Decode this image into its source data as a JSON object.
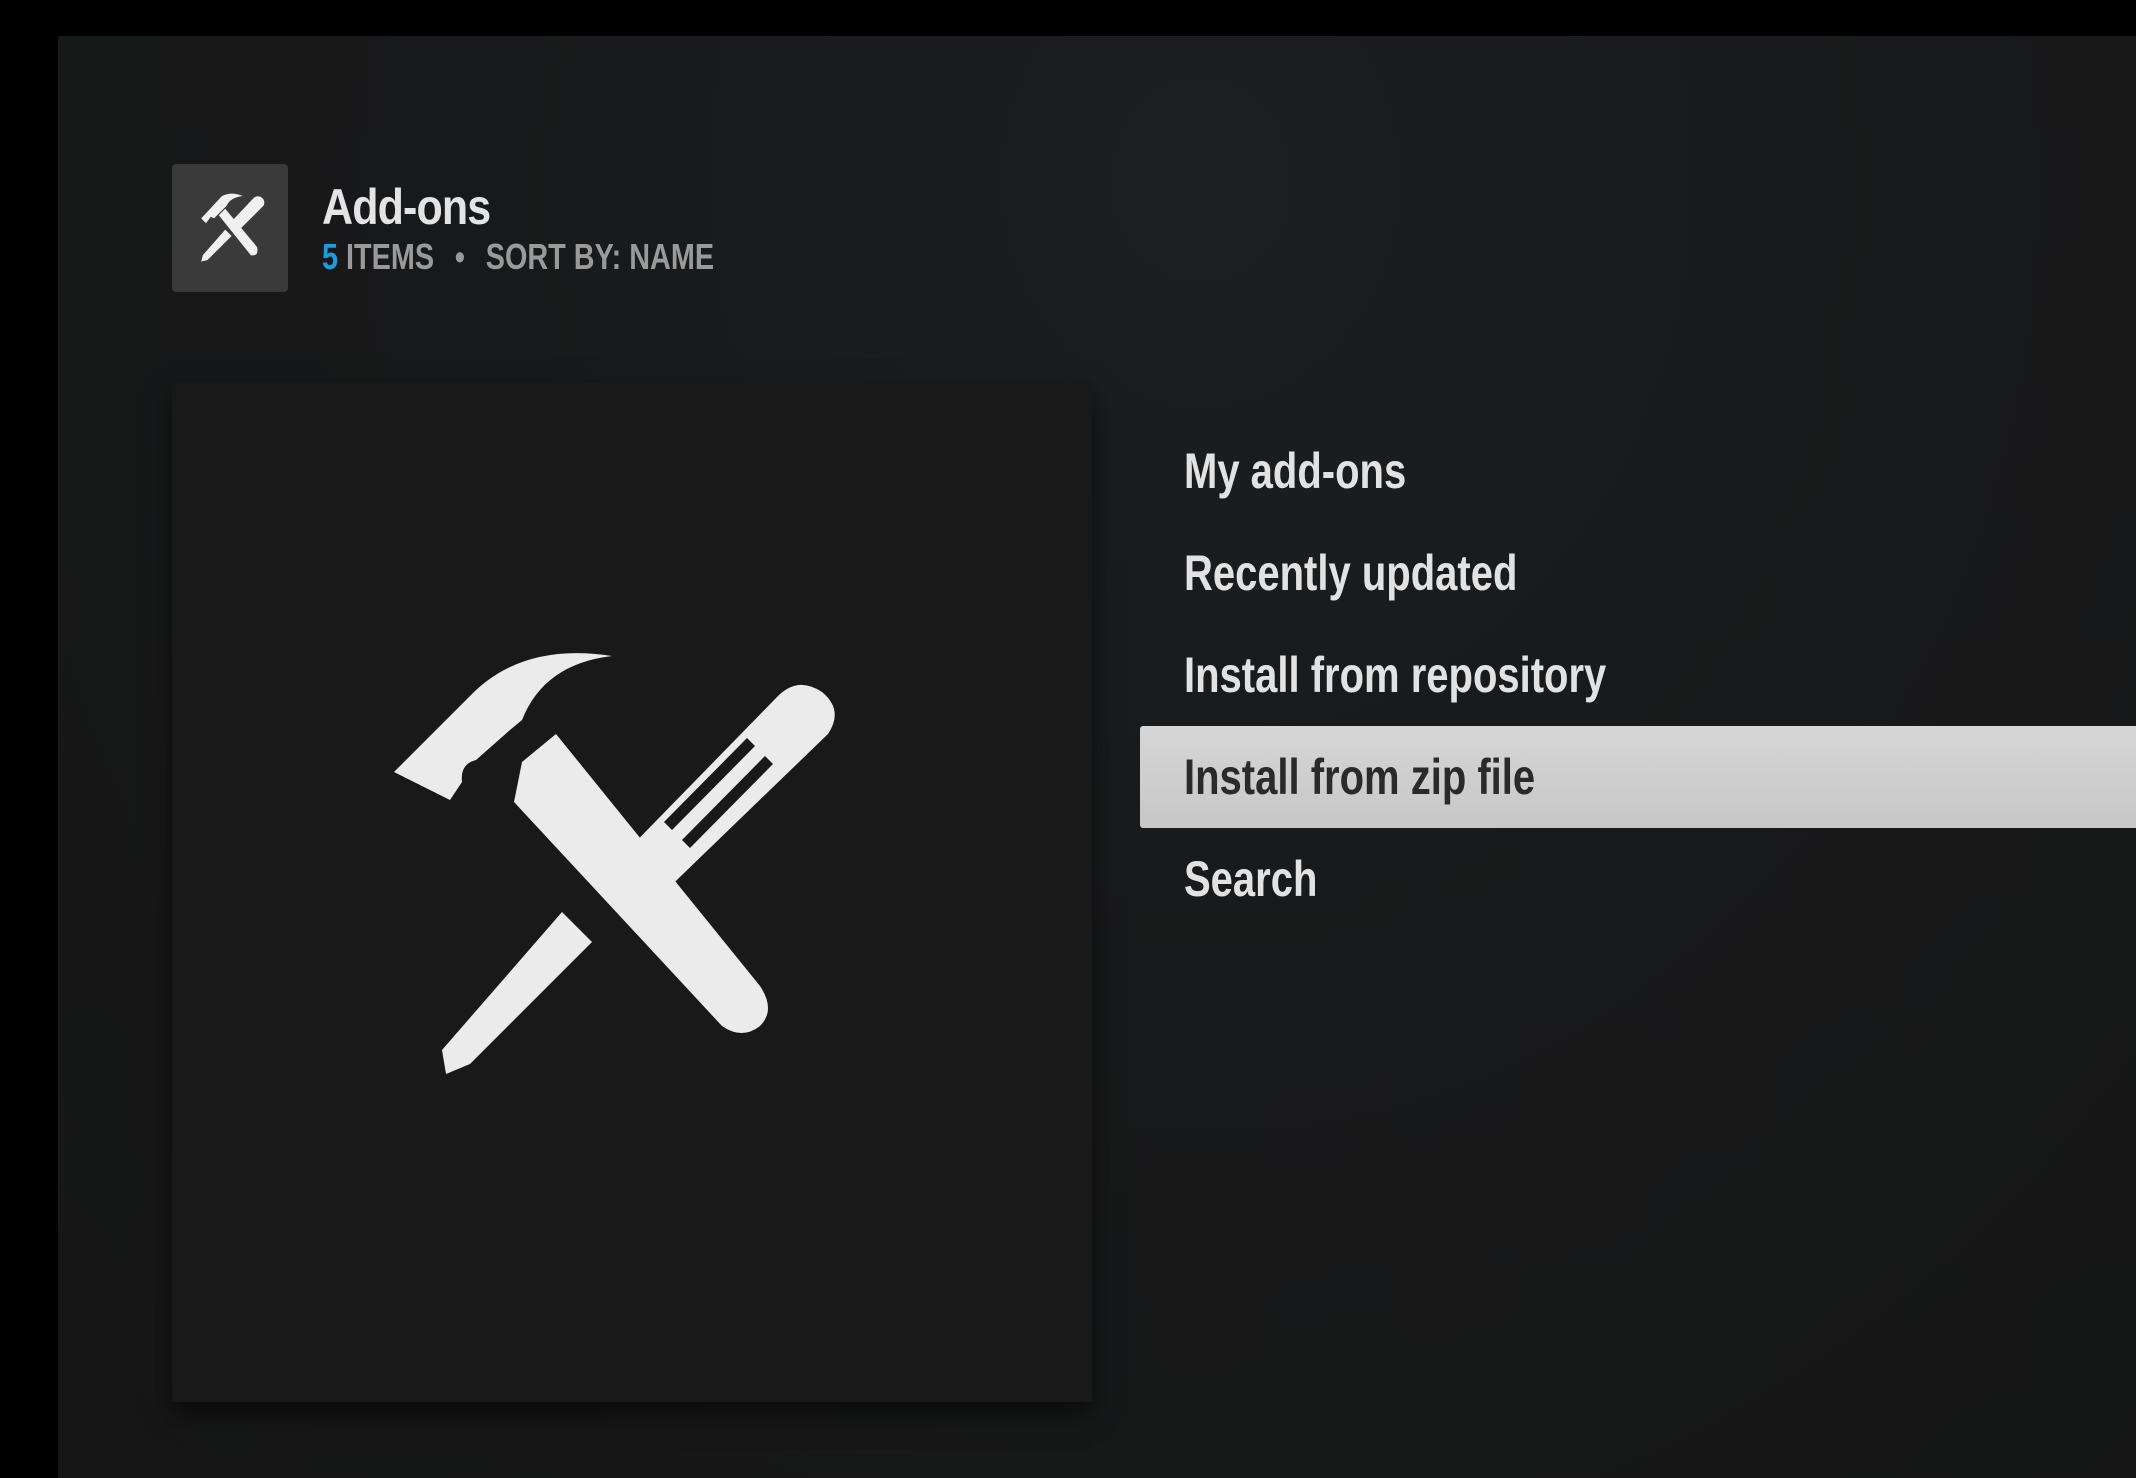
{
  "header": {
    "icon": "hammer-screwdriver-icon",
    "title": "Add-ons",
    "item_count": "5",
    "items_label": "ITEMS",
    "separator": "•",
    "sort_label": "SORT BY: NAME"
  },
  "preview": {
    "icon": "hammer-screwdriver-icon"
  },
  "menu": {
    "items": [
      {
        "label": "My add-ons",
        "focused": false
      },
      {
        "label": "Recently updated",
        "focused": false
      },
      {
        "label": "Install from repository",
        "focused": false
      },
      {
        "label": "Install from zip file",
        "focused": true
      },
      {
        "label": "Search",
        "focused": false
      }
    ]
  },
  "colors": {
    "accent": "#1d9be0",
    "focus_background": "#cfcfcf",
    "text": "#e2e2e2",
    "background": "#181818"
  }
}
